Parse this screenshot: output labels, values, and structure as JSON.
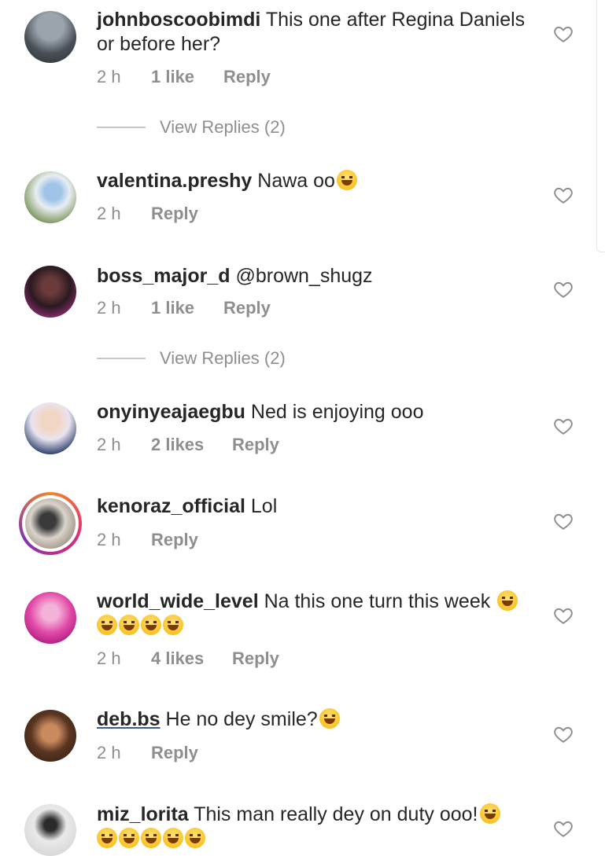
{
  "comments": [
    {
      "user": "johnboscoobimdi",
      "text": " This one after Regina Daniels or before her?",
      "time": "2 h",
      "likes": "1 like",
      "reply": "Reply",
      "view_replies": "View Replies (2)"
    },
    {
      "user": "valentina.preshy",
      "text": " Nawa oo",
      "time": "2 h",
      "reply": "Reply"
    },
    {
      "user": "boss_major_d",
      "text": " @brown_shugz",
      "time": "2 h",
      "likes": "1 like",
      "reply": "Reply",
      "view_replies": "View Replies (2)"
    },
    {
      "user": "onyinyeajaegbu",
      "text": " Ned is enjoying ooo",
      "time": "2 h",
      "likes": "2 likes",
      "reply": "Reply"
    },
    {
      "user": "kenoraz_official",
      "text": " Lol",
      "time": "2 h",
      "reply": "Reply"
    },
    {
      "user": "world_wide_level",
      "text": " Na this one turn this week",
      "time": "2 h",
      "likes": "4 likes",
      "reply": "Reply"
    },
    {
      "user": "deb.bs",
      "text": " He no dey smile?",
      "time": "2 h",
      "reply": "Reply"
    },
    {
      "user": "miz_lorita",
      "text": " This man really dey on duty ooo!"
    }
  ],
  "icons": {
    "like": "heart-outline-icon",
    "emoji": "grinning-squinting-face-emoji"
  },
  "colors": {
    "text": "#262626",
    "meta": "#8e8e8e",
    "mention": "#1a1a1a"
  }
}
